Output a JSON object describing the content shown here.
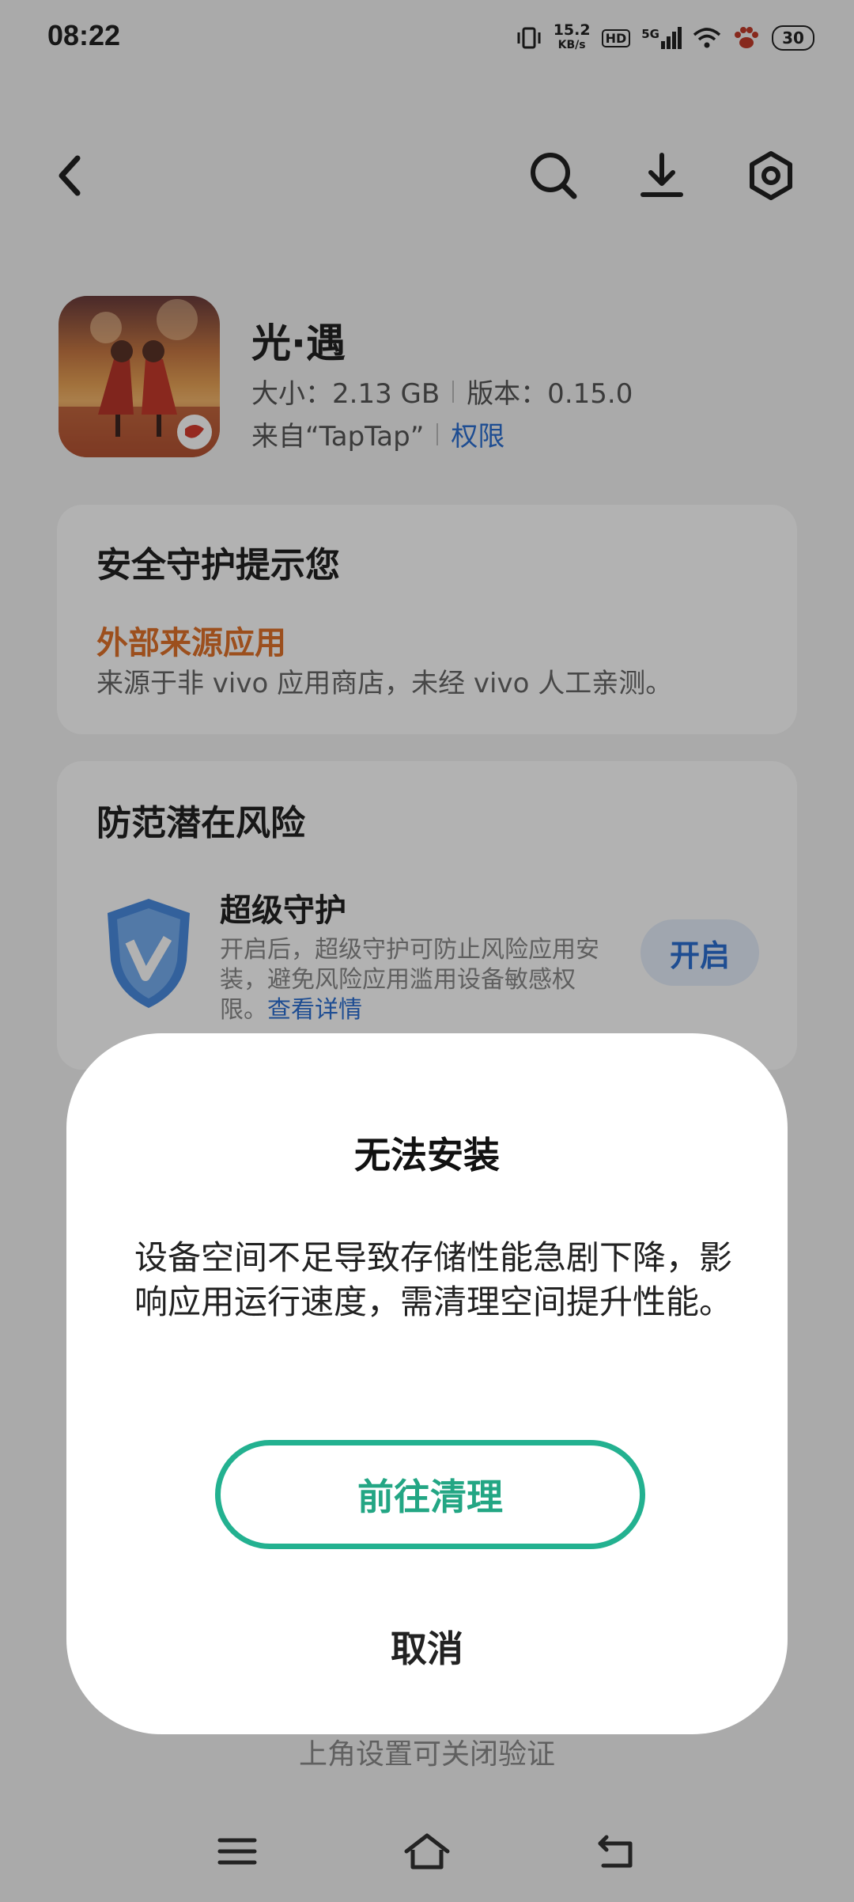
{
  "status_bar": {
    "time": "08:22",
    "speed_value": "15.2",
    "speed_unit": "KB/s",
    "hd": "HD",
    "network": "5G",
    "battery": "30"
  },
  "app": {
    "name": "光·遇",
    "size": "大小：2.13 GB",
    "version": "版本：0.15.0",
    "source": "来自“TapTap”",
    "permissions": "权限"
  },
  "security_card": {
    "title": "安全守护提示您",
    "warning": "外部来源应用",
    "desc": "来源于非 vivo 应用商店，未经 vivo 人工亲测。"
  },
  "risk_card": {
    "title": "防范潜在风险",
    "feature_name": "超级守护",
    "feature_desc": "开启后，超级守护可防止风险应用安装，避免风险应用滥用设备敏感权限。",
    "details_link": "查看详情",
    "enable_label": "开启"
  },
  "behind_text": "上角设置可关闭验证",
  "dialog": {
    "title": "无法安装",
    "message": "设备空间不足导致存储性能急剧下降，影响应用运行速度，需清理空间提升性能。",
    "primary": "前往清理",
    "cancel": "取消"
  },
  "colors": {
    "accent_green": "#23b190",
    "link_blue": "#2c6fd1",
    "warning_orange": "#e0712a"
  }
}
